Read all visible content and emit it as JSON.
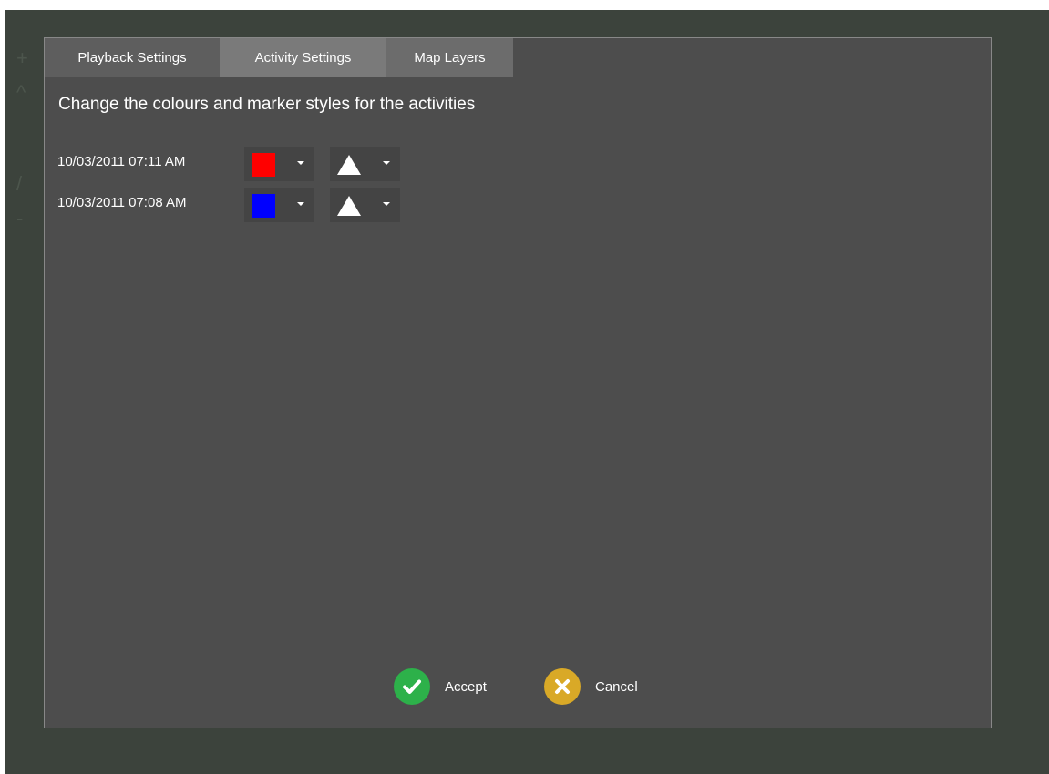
{
  "tabs": [
    {
      "label": "Playback Settings"
    },
    {
      "label": "Activity Settings"
    },
    {
      "label": "Map Layers"
    }
  ],
  "active_tab": "Activity Settings",
  "heading": "Change the colours and marker styles for the activities",
  "activities": [
    {
      "label": "10/03/2011 07:11 AM",
      "color": "#ff0000",
      "marker": "triangle-icon"
    },
    {
      "label": "10/03/2011 07:08 AM",
      "color": "#0000ff",
      "marker": "triangle-icon"
    }
  ],
  "buttons": {
    "accept": {
      "label": "Accept",
      "icon": "check-icon",
      "color": "#2db14a"
    },
    "cancel": {
      "label": "Cancel",
      "icon": "close-icon",
      "color": "#d9a927"
    }
  },
  "colors": {
    "backdrop": "#3c433c",
    "panel": "#4d4d4d",
    "active_tab": "#7a7a7a"
  }
}
